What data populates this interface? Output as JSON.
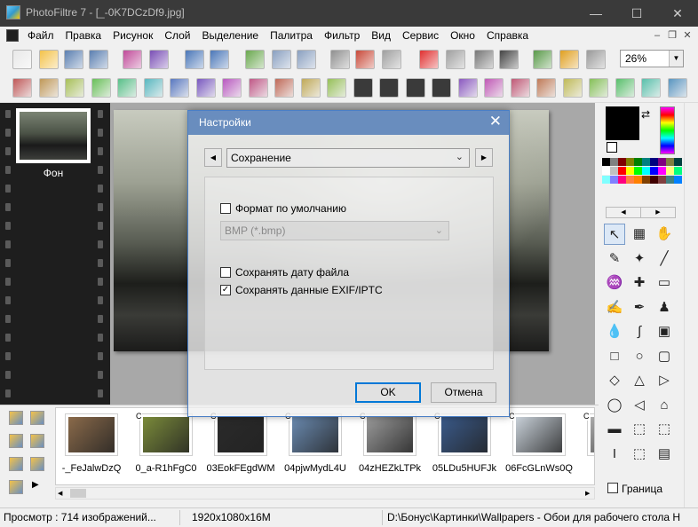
{
  "window": {
    "title": "PhotoFiltre 7 - [_-0K7DCzDf9.jpg]",
    "minimize_glyph": "—",
    "maximize_glyph": "☐",
    "close_glyph": "✕"
  },
  "menu": {
    "items": [
      "Файл",
      "Правка",
      "Рисунок",
      "Слой",
      "Выделение",
      "Палитра",
      "Фильтр",
      "Вид",
      "Сервис",
      "Окно",
      "Справка"
    ],
    "mdi_minimize": "–",
    "mdi_restore": "❐",
    "mdi_close": "✕"
  },
  "toolbar": {
    "zoom_value": "26%",
    "zoom_arrow": "▼"
  },
  "layers": {
    "layer_name": "Фон"
  },
  "dialog": {
    "title": "Настройки",
    "close_glyph": "✕",
    "prev_glyph": "◀",
    "next_glyph": "▶",
    "section": "Сохранение",
    "section_chevron": "⌄",
    "default_format_label": "Формат по умолчанию",
    "default_format_checked": false,
    "format_value": "BMP (*.bmp)",
    "format_chevron": "⌄",
    "save_date_label": "Сохранять дату файла",
    "save_date_checked": false,
    "save_exif_label": "Сохранять данные EXIF/IPTC",
    "save_exif_checked": true,
    "check_glyph": "✓",
    "ok_label": "OK",
    "cancel_label": "Отмена"
  },
  "browser": {
    "thumbnails": [
      {
        "caption": "-_FeJalwDzQ",
        "color": "#8a6a4a"
      },
      {
        "caption": "0_a-R1hFgC0",
        "color": "#7a8a3a"
      },
      {
        "caption": "03EokFEgdWM",
        "color": "#2a2a2a"
      },
      {
        "caption": "04pjwMydL4U",
        "color": "#6a8ab0"
      },
      {
        "caption": "04zHEZkLTPk",
        "color": "#9a9a9a"
      },
      {
        "caption": "05LDu5HUFJk",
        "color": "#3a5a8a"
      },
      {
        "caption": "06FcGLnWs0Q",
        "color": "#c8d0d8"
      },
      {
        "caption": "06",
        "color": "#aaaaaa"
      }
    ],
    "corner_mark": "C"
  },
  "right_panel": {
    "border_label": "Граница",
    "border_checked": false
  },
  "status": {
    "preview": "Просмотр : 714 изображений...",
    "dimensions": "1920x1080x16M",
    "path": "D:\\Бонус\\Картинки\\Wallpapers - Обои для рабочего стола H"
  },
  "colors": {
    "titlebar": "#3a3a3a",
    "dialog_title": "#527db7",
    "accent": "#0078d7",
    "palette": [
      "#000000",
      "#808080",
      "#800000",
      "#808000",
      "#008000",
      "#008080",
      "#000080",
      "#800080",
      "#808040",
      "#004040",
      "#ffffff",
      "#c0c0c0",
      "#ff0000",
      "#ffff00",
      "#00ff00",
      "#00ffff",
      "#0000ff",
      "#ff00ff",
      "#ffff80",
      "#00ff80",
      "#80ffff",
      "#8080ff",
      "#ff0080",
      "#ff8040",
      "#ff8000",
      "#804000",
      "#400000",
      "#804040",
      "#408080",
      "#0080ff"
    ]
  }
}
